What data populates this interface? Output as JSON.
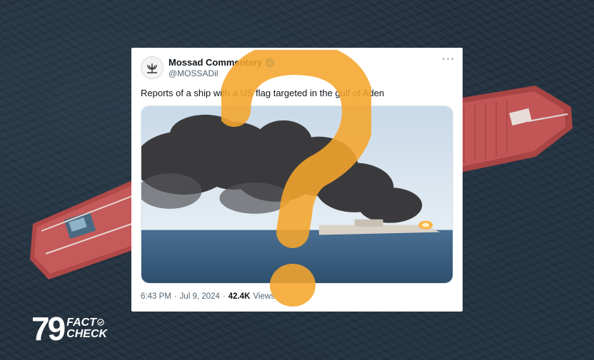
{
  "tweet": {
    "author_name": "Mossad Commentary",
    "author_handle": "@MOSSADil",
    "text": "Reports of a ship with a US flag targeted in the gulf of Aden",
    "time": "6:43 PM",
    "separator": "·",
    "date": "Jul 9, 2024",
    "views_count": "42.4K",
    "views_label": "Views"
  },
  "logo": {
    "number": "79",
    "line1": "FACT",
    "line2": "CHECK"
  },
  "colors": {
    "question_mark": "#f5a52c",
    "verified": "#1d9bf0",
    "ship_hull": "#b94b4b"
  },
  "icons": {
    "verified": "verified-badge-icon",
    "more": "more-options-icon"
  }
}
